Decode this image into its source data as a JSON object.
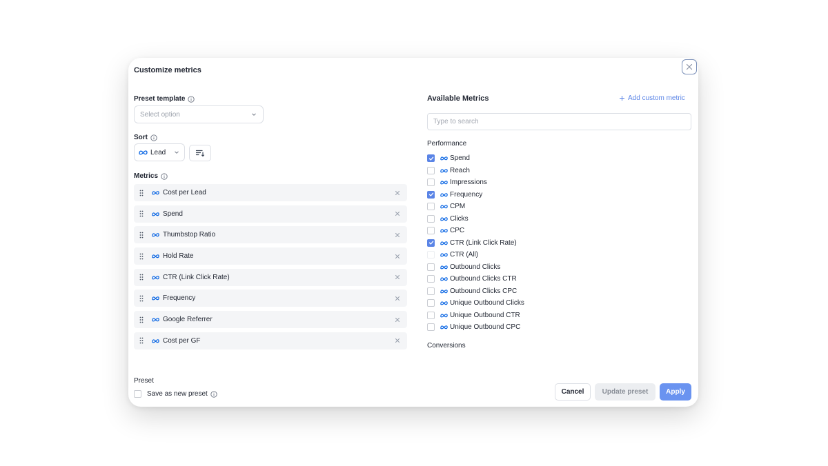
{
  "modal": {
    "title": "Customize metrics",
    "close_icon": "close-icon"
  },
  "preset_template": {
    "label": "Preset template",
    "placeholder": "Select option"
  },
  "sort": {
    "label": "Sort",
    "value": "Lead",
    "direction_icon": "sort-descending-icon"
  },
  "metrics": {
    "label": "Metrics",
    "items": [
      {
        "name": "Cost per Lead"
      },
      {
        "name": "Spend"
      },
      {
        "name": "Thumbstop Ratio"
      },
      {
        "name": "Hold Rate"
      },
      {
        "name": "CTR (Link Click Rate)"
      },
      {
        "name": "Frequency"
      },
      {
        "name": "Google Referrer"
      },
      {
        "name": "Cost per GF"
      }
    ]
  },
  "preset": {
    "label": "Preset",
    "save_as_new_label": "Save as new preset",
    "save_as_new_checked": false
  },
  "available": {
    "title": "Available Metrics",
    "add_custom_label": "Add custom metric",
    "search_placeholder": "Type to search",
    "sections": [
      {
        "title": "Performance",
        "items": [
          {
            "name": "Spend",
            "checked": true
          },
          {
            "name": "Reach",
            "checked": false
          },
          {
            "name": "Impressions",
            "checked": false
          },
          {
            "name": "Frequency",
            "checked": true
          },
          {
            "name": "CPM",
            "checked": false
          },
          {
            "name": "Clicks",
            "checked": false
          },
          {
            "name": "CPC",
            "checked": false
          },
          {
            "name": "CTR (Link Click Rate)",
            "checked": true
          },
          {
            "name": "CTR (All)",
            "checked": false
          },
          {
            "name": "Outbound Clicks",
            "checked": false
          },
          {
            "name": "Outbound Clicks CTR",
            "checked": false
          },
          {
            "name": "Outbound Clicks CPC",
            "checked": false
          },
          {
            "name": "Unique Outbound Clicks",
            "checked": false
          },
          {
            "name": "Unique Outbound CTR",
            "checked": false
          },
          {
            "name": "Unique Outbound CPC",
            "checked": false
          }
        ]
      },
      {
        "title": "Conversions",
        "items": []
      }
    ]
  },
  "buttons": {
    "cancel": "Cancel",
    "update_preset": "Update preset",
    "apply": "Apply"
  },
  "colors": {
    "accent": "#5a84e6",
    "apply": "#6a93f0",
    "meta_blue": "#0a66e4"
  }
}
